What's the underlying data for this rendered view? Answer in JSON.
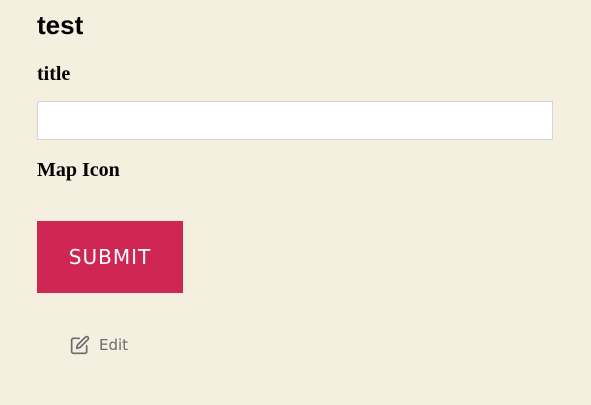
{
  "page": {
    "title": "test"
  },
  "form": {
    "title_label": "title",
    "title_value": "",
    "title_placeholder": "",
    "map_icon_label": "Map Icon",
    "submit_label": "SUBMIT"
  },
  "edit": {
    "label": "Edit",
    "icon": "edit-icon"
  },
  "colors": {
    "background": "#f5efdf",
    "submit_button": "#cf2654",
    "edit_text": "#6b6b6b"
  }
}
